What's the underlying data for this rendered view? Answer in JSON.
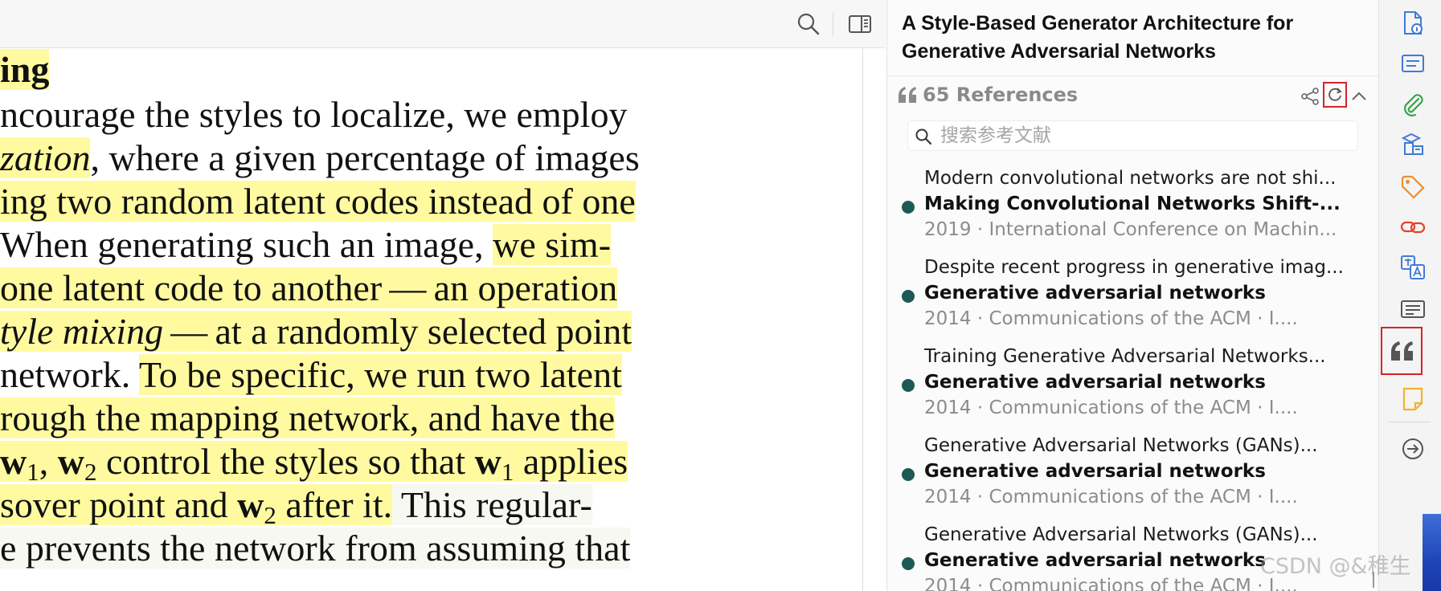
{
  "document": {
    "heading_fragment": "ing",
    "lines": [
      [
        "ncourage the styles to localize, we employ"
      ],
      [
        "zation",
        ", where a given percentage of images"
      ],
      [
        "ing two random latent codes instead of one"
      ],
      [
        " When generating such an image, ",
        "we sim-"
      ],
      [
        " one latent code to another",
        " — ",
        "an operation"
      ],
      [
        "tyle mixing",
        " — ",
        "at a randomly selected point"
      ],
      [
        "network. ",
        "To be specific, we run two latent"
      ],
      [
        "rough the mapping network, and have the"
      ],
      [
        "w",
        "1",
        ", ",
        "w",
        "2",
        " control the styles so that ",
        "w",
        "1",
        " applies"
      ],
      [
        "sover point and ",
        "w",
        "2",
        " after it.",
        "  This regular-"
      ],
      [
        "e prevents the network from assuming that"
      ]
    ]
  },
  "reader_toolbar": {
    "search_icon": "search-icon",
    "sidebar_toggle_icon": "sidebar-toggle-icon"
  },
  "item_pane": {
    "title": "A Style-Based Generator Architecture for Generative Adversarial Networks",
    "references": {
      "count_label": "65 References",
      "search_placeholder": "搜索参考文献",
      "items": [
        {
          "context": "Modern convolutional networks are not shi...",
          "title": "Making Convolutional Networks Shift-...",
          "meta": "2019 · International Conference on Machin..."
        },
        {
          "context": "Despite recent progress in generative imag...",
          "title": "Generative adversarial networks",
          "meta": "2014 · Communications of the ACM · I...."
        },
        {
          "context": "Training Generative Adversarial Networks...",
          "title": "Generative adversarial networks",
          "meta": "2014 · Communications of the ACM · I...."
        },
        {
          "context": "Generative Adversarial Networks (GANs)...",
          "title": "Generative adversarial networks",
          "meta": "2014 · Communications of the ACM · I...."
        },
        {
          "context": "Generative Adversarial Networks (GANs)...",
          "title": "Generative adversarial networks",
          "meta": "2014 · Communications of the ACM · I...."
        }
      ]
    }
  },
  "side_rail": {
    "icons": [
      "info-doc-icon",
      "abstract-icon",
      "attachment-icon",
      "libraries-icon",
      "tags-icon",
      "related-icon",
      "translate-icon",
      "text-panel-icon",
      "citations-quote-icon",
      "notes-icon",
      "locate-icon"
    ]
  },
  "watermark": "CSDN @&稚生",
  "colors": {
    "highlight": "#fffaa0",
    "reference_dot": "#1d5a55",
    "selection_box": "#d6232a",
    "rail_blue": "#3f7bd6",
    "rail_green": "#3aa24a",
    "rail_orange": "#f08c2c",
    "rail_red": "#e5412e"
  }
}
